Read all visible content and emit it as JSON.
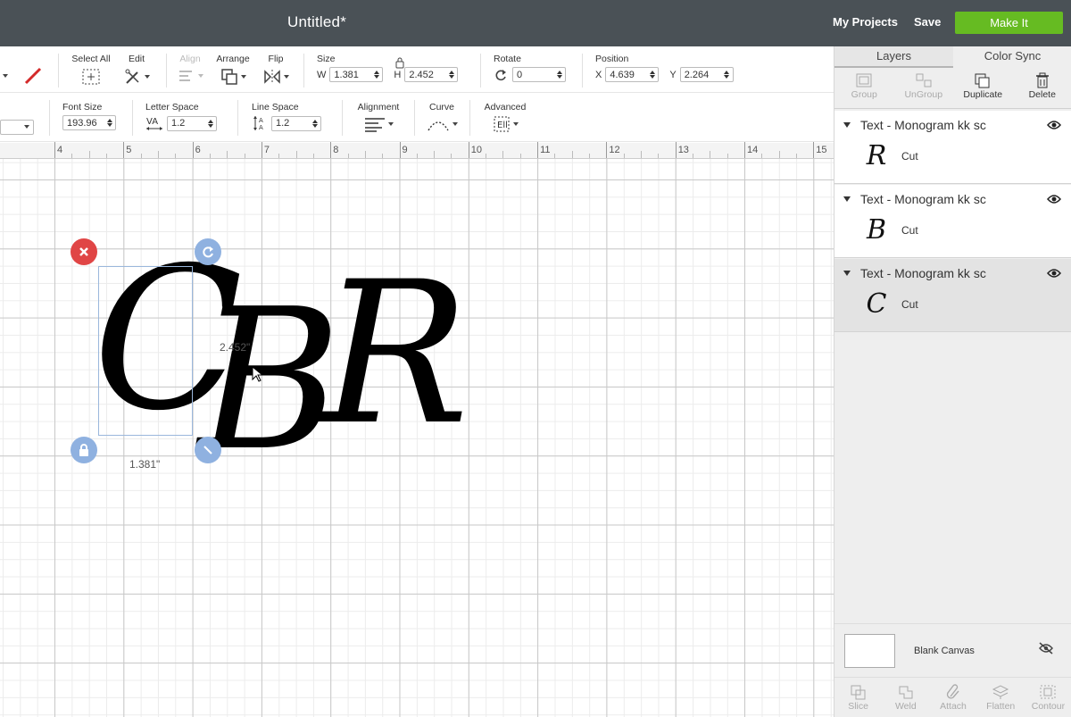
{
  "header": {
    "title": "Untitled*",
    "my_projects": "My Projects",
    "save": "Save",
    "make_it": "Make It"
  },
  "toolbar1": {
    "select_all": "Select All",
    "edit": "Edit",
    "align": "Align",
    "arrange": "Arrange",
    "flip": "Flip",
    "size": "Size",
    "w_label": "W",
    "w_value": "1.381",
    "h_label": "H",
    "h_value": "2.452",
    "rotate": "Rotate",
    "rotate_value": "0",
    "position": "Position",
    "x_label": "X",
    "x_value": "4.639",
    "y_label": "Y",
    "y_value": "2.264"
  },
  "toolbar2": {
    "font_size": "Font Size",
    "font_size_value": "193.96",
    "letter_space": "Letter Space",
    "letter_space_value": "1.2",
    "line_space": "Line Space",
    "line_space_value": "1.2",
    "alignment": "Alignment",
    "curve": "Curve",
    "advanced": "Advanced"
  },
  "ruler": {
    "ticks": [
      "4",
      "5",
      "6",
      "7",
      "8",
      "9",
      "10",
      "11",
      "12",
      "13",
      "14",
      "15"
    ]
  },
  "canvas": {
    "letters": [
      "C",
      "B",
      "R"
    ],
    "width_label": "1.381\"",
    "height_label": "2.452\""
  },
  "panel": {
    "tabs": [
      "Layers",
      "Color Sync"
    ],
    "tools": {
      "group": "Group",
      "ungroup": "UnGroup",
      "duplicate": "Duplicate",
      "delete": "Delete"
    },
    "layers": [
      {
        "name": "Text - Monogram kk sc",
        "thumb": "R",
        "op": "Cut"
      },
      {
        "name": "Text - Monogram kk sc",
        "thumb": "B",
        "op": "Cut"
      },
      {
        "name": "Text - Monogram kk sc",
        "thumb": "C",
        "op": "Cut"
      }
    ],
    "blank_canvas": "Blank Canvas",
    "footer": {
      "slice": "Slice",
      "weld": "Weld",
      "attach": "Attach",
      "flatten": "Flatten",
      "contour": "Contour"
    }
  },
  "colors": {
    "header_bg": "#4a5156",
    "make_it_bg": "#66bb22",
    "handle_delete": "#e04545",
    "handle_blue": "#8fb1e0",
    "selection_border": "#9ab7dc"
  }
}
